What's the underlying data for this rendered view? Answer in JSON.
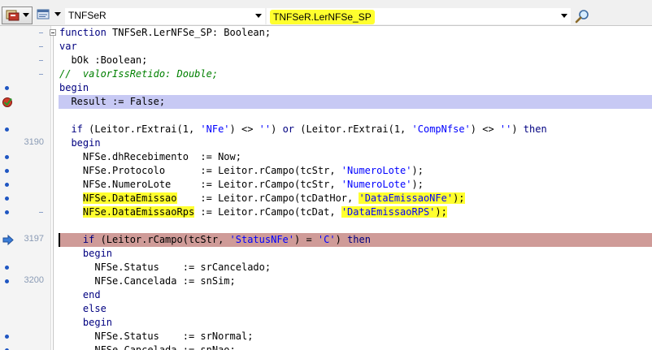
{
  "toolbar": {
    "class_combo": "TNFSeR",
    "method_combo": "TNFSeR.LerNFSe_SP",
    "search_icon": "magnifier-icon",
    "code_explorer_icon": "code-explorer-icon",
    "navigator_icon": "navigator-icon"
  },
  "editor": {
    "lines": [
      {
        "ln": "",
        "mark": "none",
        "dash": true,
        "code": "function TNFSeR.LerNFSe_SP: Boolean;"
      },
      {
        "ln": "",
        "mark": "none",
        "dash": true,
        "code": "var"
      },
      {
        "ln": "",
        "mark": "none",
        "dash": true,
        "code": "  bOk :Boolean;"
      },
      {
        "ln": "",
        "mark": "none",
        "dash": true,
        "code": "//  valorIssRetido: Double;"
      },
      {
        "ln": "",
        "mark": "dot",
        "dash": false,
        "code": "begin"
      },
      {
        "ln": "",
        "mark": "exec",
        "dash": false,
        "code": "  Result := False;"
      },
      {
        "ln": "",
        "mark": "none",
        "dash": false,
        "code": ""
      },
      {
        "ln": "",
        "mark": "dot",
        "dash": false,
        "code": "  if (Leitor.rExtrai(1, 'NFe') <> '') or (Leitor.rExtrai(1, 'CompNfse') <> '') then"
      },
      {
        "ln": "3190",
        "mark": "none",
        "dash": false,
        "code": "  begin"
      },
      {
        "ln": "",
        "mark": "dot",
        "dash": false,
        "code": "    NFSe.dhRecebimento  := Now;"
      },
      {
        "ln": "",
        "mark": "dot",
        "dash": false,
        "code": "    NFSe.Protocolo      := Leitor.rCampo(tcStr, 'NumeroLote');"
      },
      {
        "ln": "",
        "mark": "dot",
        "dash": false,
        "code": "    NFSe.NumeroLote     := Leitor.rCampo(tcStr, 'NumeroLote');"
      },
      {
        "ln": "",
        "mark": "dot",
        "dash": false,
        "code": "    NFSe.DataEmissao    := Leitor.rCampo(tcDatHor, 'DataEmissaoNFe');"
      },
      {
        "ln": "",
        "mark": "dot",
        "dash": true,
        "code": "    NFSe.DataEmissaoRps := Leitor.rCampo(tcDat, 'DataEmissaoRPS');"
      },
      {
        "ln": "",
        "mark": "none",
        "dash": false,
        "code": ""
      },
      {
        "ln": "3197",
        "mark": "arrow",
        "dash": false,
        "code": "    if (Leitor.rCampo(tcStr, 'StatusNFe') = 'C') then"
      },
      {
        "ln": "",
        "mark": "none",
        "dash": false,
        "code": "    begin"
      },
      {
        "ln": "",
        "mark": "dot",
        "dash": false,
        "code": "      NFSe.Status    := srCancelado;"
      },
      {
        "ln": "3200",
        "mark": "dot",
        "dash": false,
        "code": "      NFSe.Cancelada := snSim;"
      },
      {
        "ln": "",
        "mark": "none",
        "dash": false,
        "code": "    end"
      },
      {
        "ln": "",
        "mark": "none",
        "dash": false,
        "code": "    else"
      },
      {
        "ln": "",
        "mark": "none",
        "dash": false,
        "code": "    begin"
      },
      {
        "ln": "",
        "mark": "dot",
        "dash": false,
        "code": "      NFSe.Status    := srNormal;"
      },
      {
        "ln": "",
        "mark": "dot",
        "dash": false,
        "code": "      NFSe.Cancelada := snNao;"
      }
    ]
  },
  "colors": {
    "highlight_yellow": "#ffff2e",
    "exec_line": "#c7c9f4",
    "breakpoint_line": "#cf9b98",
    "keyword": "#000080",
    "string": "#0000ff",
    "comment": "#008000"
  }
}
